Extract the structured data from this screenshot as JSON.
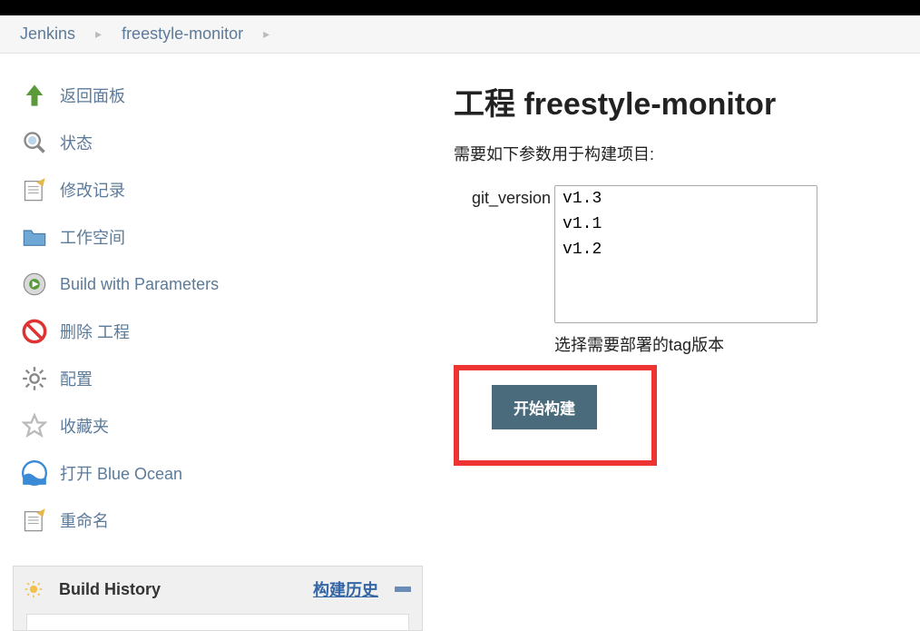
{
  "breadcrumb": {
    "items": [
      "Jenkins",
      "freestyle-monitor"
    ]
  },
  "sidebar": {
    "items": [
      {
        "label": "返回面板",
        "icon": "arrow-up-icon"
      },
      {
        "label": "状态",
        "icon": "search-icon"
      },
      {
        "label": "修改记录",
        "icon": "notepad-icon"
      },
      {
        "label": "工作空间",
        "icon": "folder-icon"
      },
      {
        "label": "Build with Parameters",
        "icon": "build-icon"
      },
      {
        "label": "删除 工程",
        "icon": "delete-icon"
      },
      {
        "label": "配置",
        "icon": "gear-icon"
      },
      {
        "label": "收藏夹",
        "icon": "star-icon"
      },
      {
        "label": "打开 Blue Ocean",
        "icon": "blueocean-icon"
      },
      {
        "label": "重命名",
        "icon": "notepad-icon"
      }
    ]
  },
  "history": {
    "title": "Build History",
    "link": "构建历史"
  },
  "content": {
    "title": "工程 freestyle-monitor",
    "desc": "需要如下参数用于构建项目:",
    "param_label": "git_version",
    "param_options": [
      "v1.3",
      "v1.1",
      "v1.2"
    ],
    "param_help": "选择需要部署的tag版本",
    "build_btn": "开始构建"
  }
}
